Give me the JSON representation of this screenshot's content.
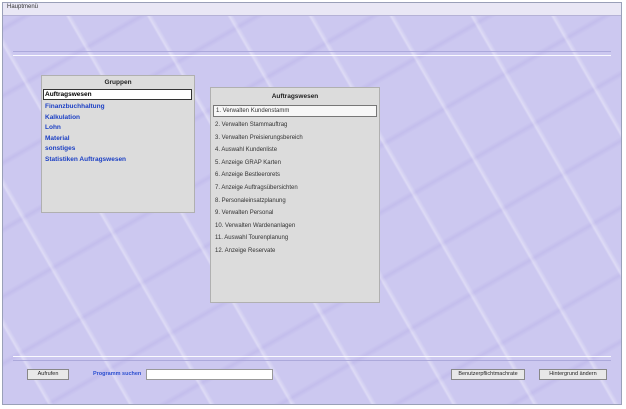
{
  "window": {
    "title": "Hauptmenü"
  },
  "groups": {
    "header": "Gruppen",
    "items": [
      "Auftragswesen",
      "Finanzbuchhaltung",
      "Kalkulation",
      "Lohn",
      "Material",
      "sonstiges",
      "Statistiken Auftragswesen"
    ],
    "selected_index": 0
  },
  "tasks": {
    "header": "Auftragswesen",
    "items": [
      "1. Verwalten Kundenstamm",
      "2. Verwalten Stammauftrag",
      "3. Verwalten Preisierungsbereich",
      "4. Auswahl Kundenliste",
      "5. Anzeige GRAP Karten",
      "6. Anzeige Bestleerorets",
      "7. Anzeige Auftragsübersichten",
      "8. Personaleinsatzplanung",
      "9. Verwalten Personal",
      "10. Verwalten Wardenanlagen",
      "11. Auswahl Tourenplanung",
      "12. Anzeige Reservate"
    ],
    "selected_index": 0
  },
  "footer": {
    "left_button": "Aufrufen",
    "search_label": "Programm suchen",
    "search_value": "",
    "right_button_1": "Benutzerpflichtmachrate",
    "right_button_2": "Hintergrund ändern"
  }
}
